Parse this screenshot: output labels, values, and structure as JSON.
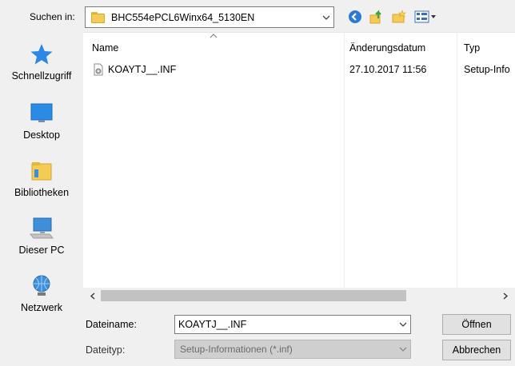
{
  "toolbar": {
    "look_in_label": "Suchen in:",
    "look_in_value": "BHC554ePCL6Winx64_5130EN"
  },
  "places": [
    {
      "label": "Schnellzugriff",
      "icon": "star-icon"
    },
    {
      "label": "Desktop",
      "icon": "desktop-icon"
    },
    {
      "label": "Bibliotheken",
      "icon": "libraries-icon"
    },
    {
      "label": "Dieser PC",
      "icon": "computer-icon"
    },
    {
      "label": "Netzwerk",
      "icon": "network-icon"
    }
  ],
  "file_list": {
    "columns": [
      "Name",
      "Änderungsdatum",
      "Typ"
    ],
    "rows": [
      {
        "name": "KOAYTJ__.INF",
        "date": "27.10.2017 11:56",
        "type": "Setup-Info"
      }
    ]
  },
  "bottom": {
    "filename_label": "Dateiname:",
    "filename_value": "KOAYTJ__.INF",
    "filetype_label": "Dateityp:",
    "filetype_value": "Setup-Informationen (*.inf)",
    "open_label": "Öffnen",
    "cancel_label": "Abbrechen"
  },
  "colors": {
    "accent": "#1e88e5",
    "folder": "#f4cb55"
  }
}
